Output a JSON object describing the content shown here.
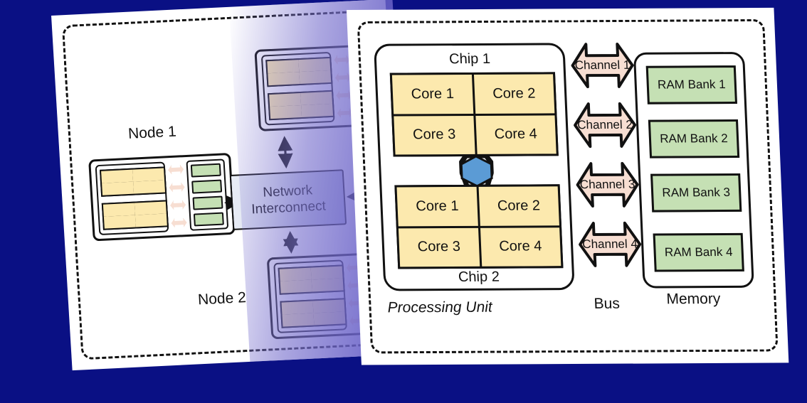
{
  "background_color": "#0a1084",
  "palette": {
    "core_fill": "#fce9ae",
    "ram_fill": "#c5e0b4",
    "channel_fill": "#f7ded2",
    "hexagon_fill": "#5b9bd5",
    "interconnect_fill": "#ccd2e8",
    "outline": "#111111",
    "card_fill": "#ffffff"
  },
  "back_card": {
    "name": "cluster-diagram-card",
    "nodes": [
      {
        "label": "Node 1",
        "id": "node-1"
      },
      {
        "label": "Node 2",
        "id": "node-2"
      },
      {
        "label": "",
        "id": "node-top"
      }
    ],
    "interconnect": {
      "line1": "Network",
      "line2": "Interconnect"
    },
    "partial_text": "N"
  },
  "front_card": {
    "name": "processing-unit-card",
    "processing_unit": {
      "chip1_title": "Chip 1",
      "chip2_title": "Chip 2",
      "chip1_cores": [
        "Core 1",
        "Core 2",
        "Core 3",
        "Core 4"
      ],
      "chip2_cores": [
        "Core 1",
        "Core 2",
        "Core 3",
        "Core 4"
      ],
      "interconnect_icon": "hexagon-icon"
    },
    "bus": {
      "channels": [
        "Channel 1",
        "Channel 2",
        "Channel 3",
        "Channel 4"
      ]
    },
    "memory": {
      "banks": [
        "RAM Bank 1",
        "RAM Bank 2",
        "RAM Bank 3",
        "RAM Bank 4"
      ]
    },
    "footer_labels": {
      "processing_unit": "Processing Unit",
      "bus": "Bus",
      "memory": "Memory"
    }
  }
}
